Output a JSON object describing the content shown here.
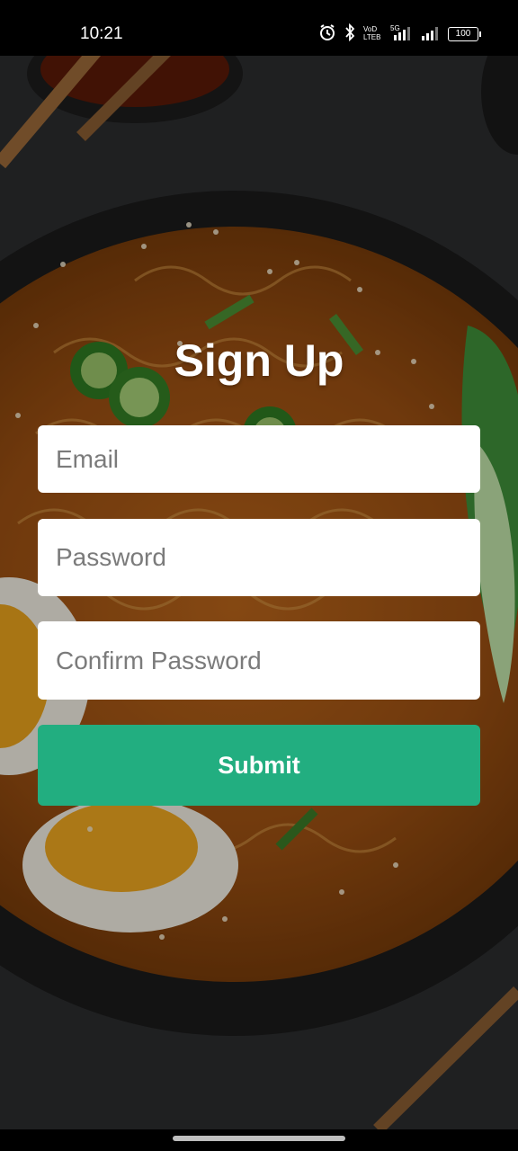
{
  "status_bar": {
    "time": "10:21",
    "battery": "100",
    "icons": [
      "alarm-icon",
      "bluetooth-icon",
      "volte-icon",
      "5g-signal-icon",
      "signal-icon",
      "battery-icon"
    ]
  },
  "page": {
    "title": "Sign Up"
  },
  "form": {
    "email_placeholder": "Email",
    "email_value": "",
    "password_placeholder": "Password",
    "password_value": "",
    "confirm_placeholder": "Confirm Password",
    "confirm_value": "",
    "submit_label": "Submit"
  },
  "colors": {
    "accent": "#22ae80",
    "field_bg": "#ffffff",
    "title": "#ffffff"
  }
}
